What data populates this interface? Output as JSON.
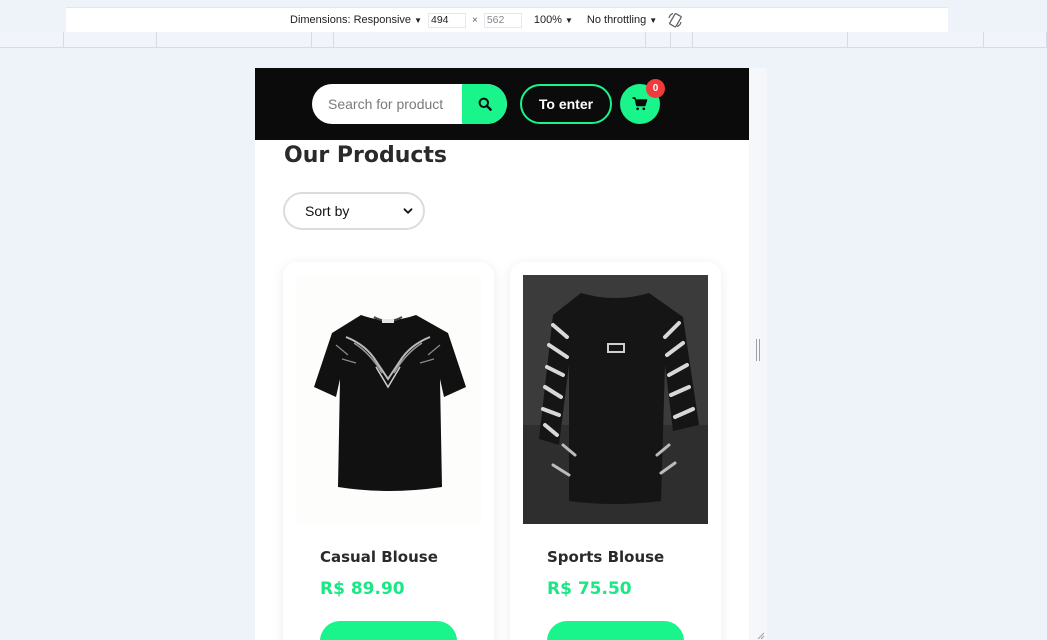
{
  "devtools": {
    "dimensions_label": "Dimensions: Responsive",
    "width_value": "494",
    "height_value": "562",
    "times_symbol": "×",
    "zoom": "100%",
    "throttling": "No throttling",
    "caret": "▼"
  },
  "header": {
    "search_placeholder": "Search for product",
    "enter_label": "To enter",
    "cart_count": "0"
  },
  "main": {
    "title": "Our Products",
    "sort_label": "Sort by"
  },
  "products": [
    {
      "name": "Casual Blouse",
      "price": "R$ 89.90"
    },
    {
      "name": "Sports Blouse",
      "price": "R$ 75.50"
    }
  ],
  "colors": {
    "accent": "#19f58a",
    "header_bg": "#0b0b0b",
    "badge": "#ef3b3b"
  }
}
